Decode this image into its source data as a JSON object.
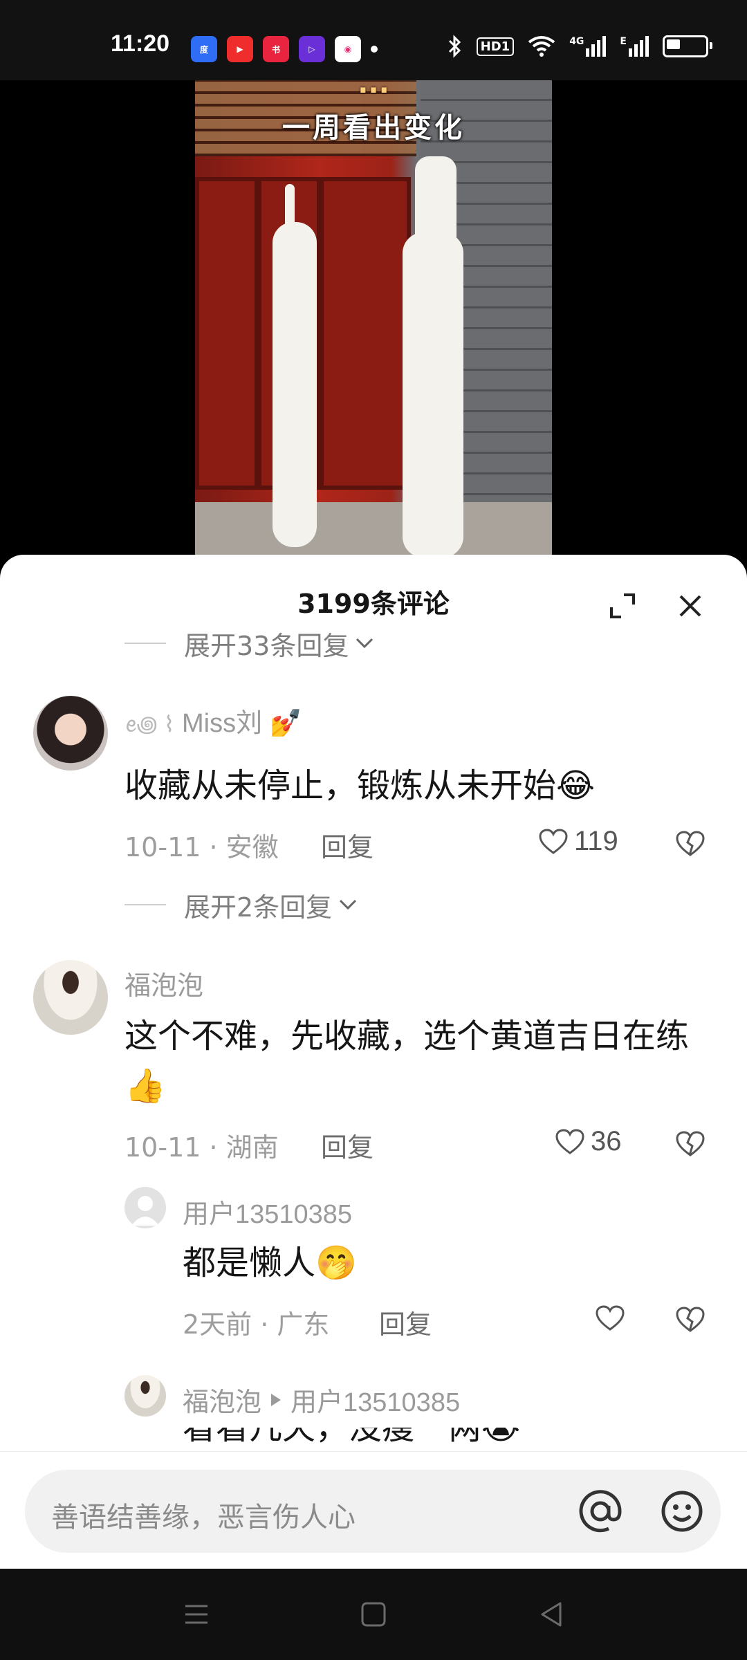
{
  "status_bar": {
    "time": "11:20",
    "app_icons": [
      "baidu-app-icon",
      "video-app-icon",
      "xiaohongshu-app-icon",
      "purple-play-app-icon",
      "kuaishou-app-icon"
    ],
    "hd_label": "HD1",
    "net_labels": [
      "4G",
      "E"
    ],
    "battery_level": 0.4
  },
  "video": {
    "caption_partial": "一周看出变化",
    "caption_top_partial": "..."
  },
  "comments_sheet": {
    "title": "3199条评论",
    "expand_top": "展开33条回复",
    "comments": [
      {
        "username": "Miss刘",
        "text": "收藏从未停止，锻炼从未开始😂",
        "date_location": "10-11 · 安徽",
        "reply_label": "回复",
        "likes": "119"
      },
      {
        "username": "福泡泡",
        "text": "这个不难，先收藏，选个黄道吉日在练👍",
        "date_location": "10-11 · 湖南",
        "reply_label": "回复",
        "likes": "36"
      }
    ],
    "expand_middle": "展开2条回复",
    "replies": [
      {
        "username": "用户13510385",
        "text": "都是懒人🤭",
        "date_location": "2天前 · 广东",
        "reply_label": "回复"
      },
      {
        "username": "福泡泡",
        "reply_to": "用户13510385",
        "text_partial": "看看几天，没瘦一两😭"
      }
    ]
  },
  "input_bar": {
    "placeholder": "善语结善缘，恶言伤人心"
  },
  "nav_bar": {
    "buttons": [
      "menu-icon",
      "home-icon",
      "back-icon"
    ]
  }
}
